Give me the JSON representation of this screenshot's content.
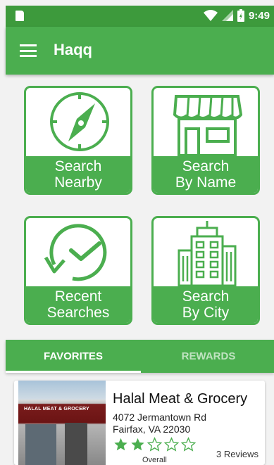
{
  "status_bar": {
    "time": "9:49"
  },
  "app_bar": {
    "title": "Haqq"
  },
  "tiles": [
    {
      "line1": "Search",
      "line2": "Nearby"
    },
    {
      "line1": "Search",
      "line2": "By Name"
    },
    {
      "line1": "Recent",
      "line2": "Searches"
    },
    {
      "line1": "Search",
      "line2": "By City"
    }
  ],
  "tabs": {
    "favorites": "FAVORITES",
    "rewards": "REWARDS"
  },
  "favorite": {
    "name": "Halal Meat & Grocery",
    "address_line1": "4072 Jermantown Rd",
    "address_line2": "Fairfax, VA 22030",
    "sign_text": "HALAL MEAT & GROCERY",
    "rating": 2,
    "rating_max": 5,
    "reviews": "3  Reviews",
    "rating_label": "Overall"
  },
  "colors": {
    "primary": "#4bae4f",
    "primary_dark": "#3d9a3c"
  }
}
